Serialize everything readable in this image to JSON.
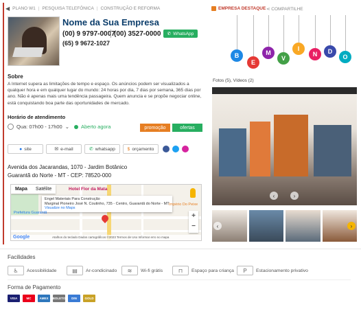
{
  "breadcrumb": {
    "plan": "PLANO W1",
    "cat1": "PESQUISA TELEFÔNICA",
    "cat2": "CONSTRUÇÃO E REFORMA"
  },
  "business": {
    "name": "Nome da Sua Empresa",
    "phone1": "(00) 9 9797-0007",
    "phone2": "(00) 3527-0000",
    "phone3": "(65) 9 9672-1027",
    "whatsapp_label": "WhatsApp"
  },
  "about": {
    "heading": "Sobre",
    "text": "A Internet supera as limitações de tempo e espaço. Os anúncios podem ser visualizados a qualquer hora e em qualquer lugar do mundo: 24 horas por dia, 7 dias por semana, 365 dias por ano. Não é apenas mais uma tendência passageira. Quem anuncia e se propõe negociar online, está conquistando boa parte das oportunidades de mercado."
  },
  "hours": {
    "heading": "Horário de atendimento",
    "today": "Qua: 07h00 - 17h00",
    "status": "Aberto agora",
    "promo_label": "promoção",
    "offers_label": "ofertas"
  },
  "contact_buttons": {
    "site": "site",
    "email": "e-mail",
    "whatsapp": "whatsapp",
    "quote": "orçamento"
  },
  "address": {
    "line1": "Avenida dos Jacarandas, 1070 - Jardim Botânico",
    "line2": "Guarantã do Norte - MT - CEP: 78520-000"
  },
  "map": {
    "tab_map": "Mapa",
    "tab_satellite": "Satélite",
    "hotel": "Hotel Flor da Mata",
    "popup_title": "Engel Materiais Para Construção",
    "popup_addr": "Marginal Pioneiro José N. Coutinho, 735 - Centro, Guarantã do Norte - MT",
    "popup_link": "Visualize no Maps",
    "label_guaranta": "Prefeitura Guarantã",
    "label_imperio": "Império Do Peixe",
    "footer": "Atalhos do teclado   Dados cartográficos ©2023   Termos de Uso   Informar erro no mapa",
    "google": "Google"
  },
  "header_right": {
    "destaque": "EMPRESA DESTAQUE",
    "share": "COMPARTILHE"
  },
  "banner_letters": [
    "B",
    "E",
    "M",
    "V",
    "I",
    "N",
    "D",
    "O"
  ],
  "banner_colors": [
    "#1e88e5",
    "#e53935",
    "#8e24aa",
    "#43a047",
    "#f9a825",
    "#e91e63",
    "#3949ab",
    "#00acc1"
  ],
  "gallery": {
    "label": "Fotos (5), Vídeos (2)"
  },
  "facilities": {
    "heading": "Facilidades",
    "items": [
      "Acessibilidade",
      "Ar-condicinado",
      "Wi-fi grátis",
      "Espaço para criança",
      "Estacionamento privativo"
    ]
  },
  "payment": {
    "heading": "Forma de Pagamento",
    "items": [
      "VISA",
      "MC",
      "AMEX",
      "BOLETO",
      "DIN",
      "GOLD"
    ]
  }
}
